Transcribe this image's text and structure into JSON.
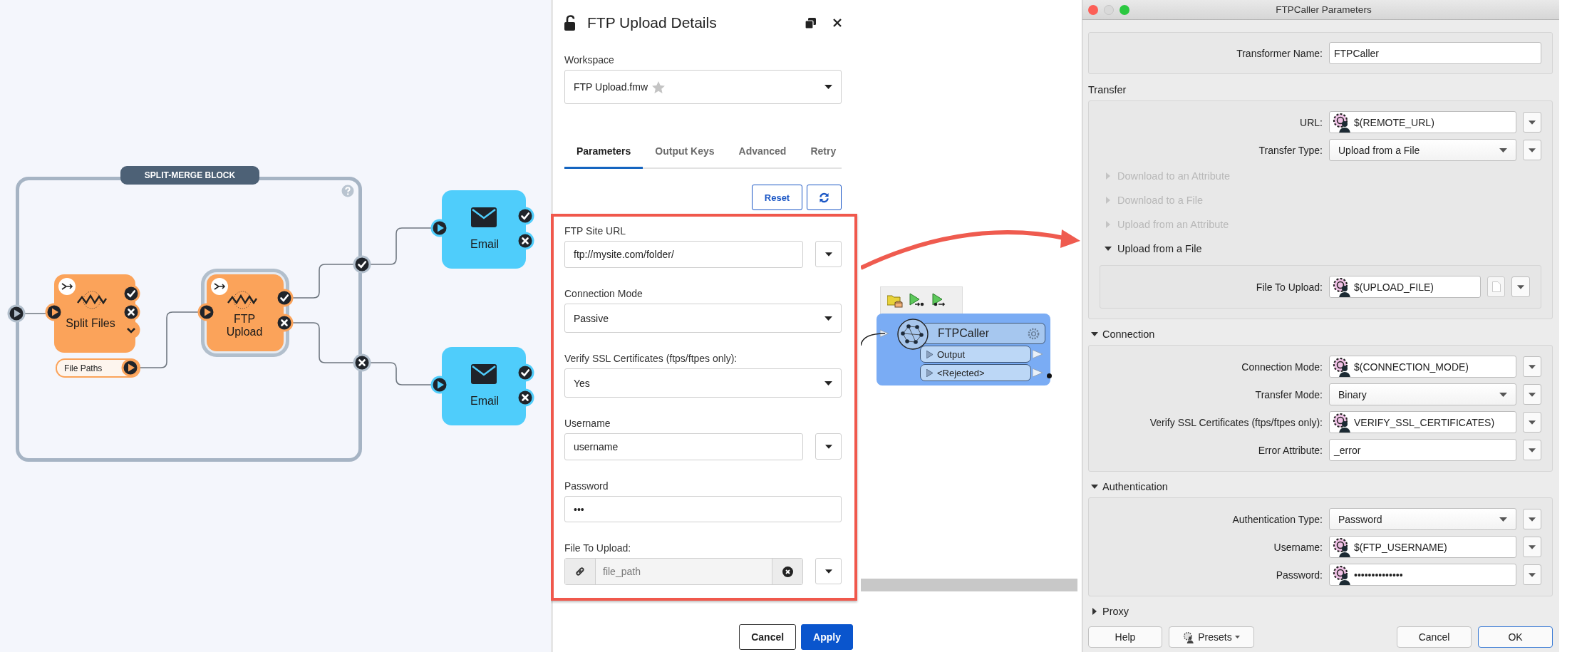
{
  "canvas": {
    "block": {
      "title": "SPLIT-MERGE BLOCK"
    },
    "nodes": [
      {
        "kind": "action",
        "label": "Split Files",
        "selected": false,
        "port": "File Paths"
      },
      {
        "kind": "action",
        "label": "FTP Upload",
        "selected": true
      },
      {
        "kind": "email",
        "label": "Email"
      },
      {
        "kind": "email",
        "label": "Email"
      }
    ]
  },
  "panel": {
    "title": "FTP Upload Details",
    "workspace": {
      "label": "Workspace",
      "value": "FTP Upload.fmw"
    },
    "tabs": [
      {
        "label": "Parameters",
        "selected": true
      },
      {
        "label": "Output Keys",
        "selected": false
      },
      {
        "label": "Advanced",
        "selected": false
      },
      {
        "label": "Retry",
        "selected": false
      }
    ],
    "reset": "Reset",
    "fields": [
      {
        "kind": "text",
        "label": "FTP Site URL",
        "value": "ftp://mysite.com/folder/"
      },
      {
        "kind": "select",
        "label": "Connection Mode",
        "value": "Passive"
      },
      {
        "kind": "select",
        "label": "Verify SSL Certificates (ftps/ftpes only):",
        "value": "Yes"
      },
      {
        "kind": "text",
        "label": "Username",
        "value": "username"
      },
      {
        "kind": "password",
        "label": "Password",
        "value": "•••"
      },
      {
        "kind": "file",
        "label": "File To Upload:",
        "value": "file_path"
      }
    ],
    "buttons": [
      {
        "label": "Cancel",
        "primary": false
      },
      {
        "label": "Apply",
        "primary": true
      }
    ]
  },
  "transformer": {
    "name": "FTPCaller",
    "ports": [
      "Output",
      "<Rejected>"
    ]
  },
  "dialog": {
    "title": "FTPCaller Parameters",
    "transformer_name": {
      "label": "Transformer Name:",
      "value": "FTPCaller"
    },
    "sections": [
      {
        "kind": "plain",
        "title": "Transfer",
        "rows": [
          {
            "kind": "variable",
            "label": "URL:",
            "value": "$(REMOTE_URL)"
          },
          {
            "kind": "select",
            "label": "Transfer Type:",
            "value": "Upload from a File"
          }
        ],
        "subsections": [
          {
            "title": "Download to an Attribute",
            "expanded": false,
            "disabled": true
          },
          {
            "title": "Download to a File",
            "expanded": false,
            "disabled": true
          },
          {
            "title": "Upload from an Attribute",
            "expanded": false,
            "disabled": true
          },
          {
            "title": "Upload from a File",
            "expanded": true,
            "disabled": false,
            "rows": [
              {
                "kind": "variable_file",
                "label": "File To Upload:",
                "value": "$(UPLOAD_FILE)"
              }
            ]
          }
        ]
      },
      {
        "kind": "collapsible",
        "title": "Connection",
        "expanded": true,
        "rows": [
          {
            "kind": "variable",
            "label": "Connection Mode:",
            "value": "$(CONNECTION_MODE)"
          },
          {
            "kind": "select",
            "label": "Transfer Mode:",
            "value": "Binary"
          },
          {
            "kind": "variable",
            "label": "Verify SSL Certificates (ftps/ftpes only):",
            "value": "VERIFY_SSL_CERTIFICATES)"
          },
          {
            "kind": "text",
            "label": "Error Attribute:",
            "value": "_error"
          }
        ]
      },
      {
        "kind": "collapsible",
        "title": "Authentication",
        "expanded": true,
        "rows": [
          {
            "kind": "select",
            "label": "Authentication Type:",
            "value": "Password"
          },
          {
            "kind": "variable",
            "label": "Username:",
            "value": "$(FTP_USERNAME)"
          },
          {
            "kind": "variable",
            "label": "Password:",
            "value": "••••••••••••••"
          }
        ]
      },
      {
        "kind": "collapsible",
        "title": "Proxy",
        "expanded": false
      }
    ],
    "buttons_left": [
      {
        "kind": "plain",
        "label": "Help"
      },
      {
        "kind": "menu",
        "label": "Presets"
      }
    ],
    "buttons_right": [
      {
        "label": "Cancel",
        "default": false
      },
      {
        "label": "OK",
        "default": true
      }
    ]
  }
}
